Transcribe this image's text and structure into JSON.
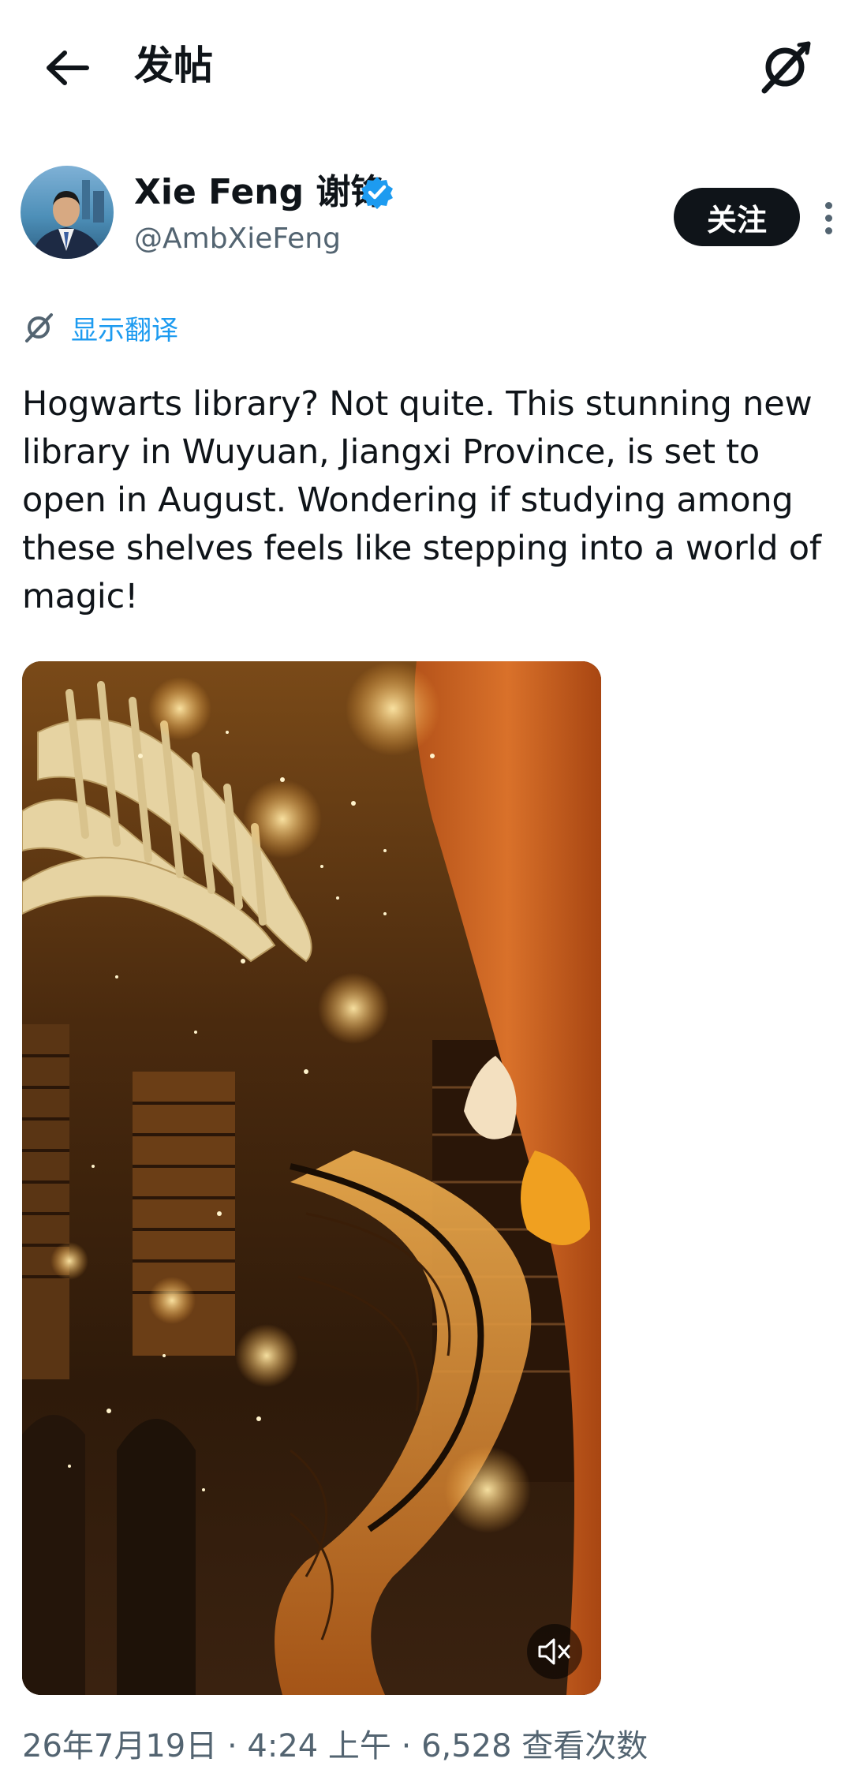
{
  "header": {
    "title": "发帖",
    "back_icon": "arrow-left-icon",
    "translate_icon": "translate-off-icon"
  },
  "author": {
    "name": "Xie Feng 谢锋",
    "handle": "@AmbXieFeng",
    "verified": true,
    "verified_color": "#1d9bf0",
    "follow_label": "关注",
    "more_icon": "more-vertical-icon"
  },
  "translation": {
    "label": "显示翻译",
    "icon": "translate-icon",
    "color": "#1d9bf0"
  },
  "tweet": {
    "text": "Hogwarts library? Not quite. This stunning new library in Wuyuan, Jiangxi Province, is set to open in August. Wondering if studying among these shelves feels like stepping into a world of magic!"
  },
  "media": {
    "type": "video",
    "mute_icon": "volume-muted-icon"
  },
  "meta": {
    "timestamp": "26年7月19日 · 4:24 上午 · 6,528 查看次数"
  }
}
